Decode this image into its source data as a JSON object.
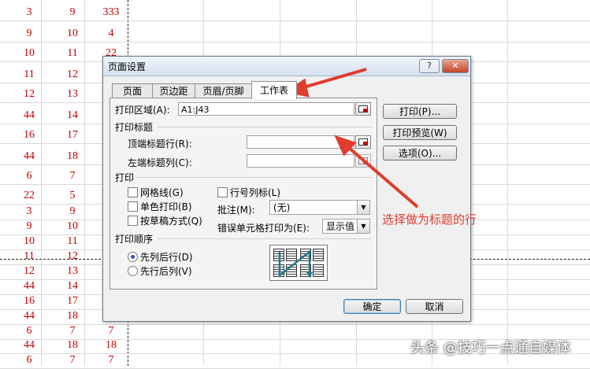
{
  "sheet": {
    "rows": [
      [
        "3",
        "9",
        "333"
      ],
      [
        "9",
        "10",
        "4"
      ],
      [
        "10",
        "11",
        "22"
      ],
      [
        "11",
        "12",
        ""
      ],
      [
        "12",
        "13",
        ""
      ],
      [
        "44",
        "14",
        ""
      ],
      [
        "16",
        "17",
        ""
      ],
      [
        "44",
        "18",
        ""
      ],
      [
        "6",
        "7",
        ""
      ],
      [
        "22",
        "5",
        ""
      ],
      [
        "3",
        "9",
        ""
      ],
      [
        "9",
        "10",
        ""
      ],
      [
        "10",
        "11",
        ""
      ],
      [
        "11",
        "12",
        ""
      ],
      [
        "12",
        "13",
        ""
      ],
      [
        "44",
        "14",
        ""
      ],
      [
        "16",
        "17",
        ""
      ],
      [
        "44",
        "18",
        ""
      ],
      [
        "6",
        "7",
        "7"
      ],
      [
        "44",
        "18",
        "18"
      ],
      [
        "6",
        "7",
        "7"
      ]
    ]
  },
  "dialog": {
    "title": "页面设置",
    "help": "?",
    "close": "✕",
    "tabs": [
      {
        "label": "页面"
      },
      {
        "label": "页边距"
      },
      {
        "label": "页眉/页脚"
      },
      {
        "label": "工作表",
        "active": true
      }
    ],
    "print_area": {
      "label": "打印区域(A):",
      "value": "A1:J43"
    },
    "print_titles": {
      "group": "打印标题",
      "top_rows_label": "顶端标题行(R):",
      "top_rows_value": "",
      "left_cols_label": "左端标题列(C):",
      "left_cols_value": ""
    },
    "print": {
      "group": "打印",
      "gridlines": "网格线(G)",
      "mono": "单色打印(B)",
      "draft": "按草稿方式(Q)",
      "row_col_headers": "行号列标(L)",
      "comments_label": "批注(M):",
      "comments_value": "(无)",
      "errors_label": "错误单元格打印为(E):",
      "errors_value": "显示值"
    },
    "order": {
      "group": "打印顺序",
      "down_then_over": "先列后行(D)",
      "over_then_down": "先行后列(V)",
      "selected": "down_then_over"
    },
    "buttons": {
      "print": "打印(P)...",
      "preview": "打印预览(W)",
      "options": "选项(O)...",
      "ok": "确定",
      "cancel": "取消"
    }
  },
  "annotation": "选择做为标题的行",
  "watermark": "头条 @技巧一点通自媒体",
  "colors": {
    "accent": "#e03c2c",
    "cell_text": "#c00000"
  }
}
